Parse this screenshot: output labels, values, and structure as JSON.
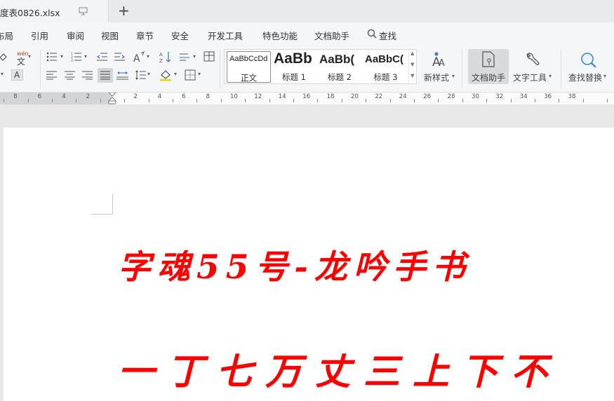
{
  "tab": {
    "title": "度表0826.xlsx",
    "add_label": "+"
  },
  "menu": {
    "items": [
      "布局",
      "引用",
      "审阅",
      "视图",
      "章节",
      "安全",
      "开发工具",
      "特色功能",
      "文档助手"
    ],
    "search_label": "查找"
  },
  "ribbon": {
    "pinyin_glyph": "wén",
    "pinyin_char": "文",
    "styles": [
      {
        "sample": "AaBbCcDd",
        "label": "正文"
      },
      {
        "sample": "AaBb",
        "label": "标题 1"
      },
      {
        "sample": "AaBb(",
        "label": "标题 2"
      },
      {
        "sample": "AaBbC(",
        "label": "标题 3"
      }
    ],
    "new_style_label": "新样式",
    "doc_helper_label": "文档助手",
    "text_tools_label": "文字工具",
    "find_replace_label": "查找替换"
  },
  "ruler": {
    "left_ticks": [
      "8",
      "6",
      "4",
      "2"
    ],
    "right_ticks": [
      "2",
      "4",
      "6",
      "8",
      "10",
      "12",
      "14",
      "16",
      "18",
      "20",
      "22",
      "24",
      "26",
      "28",
      "30",
      "32",
      "34",
      "36",
      "38"
    ]
  },
  "document": {
    "line1": "字魂55号-龙吟手书",
    "line2": "一丁七万丈三上下不",
    "text_color": "#ff0000"
  }
}
